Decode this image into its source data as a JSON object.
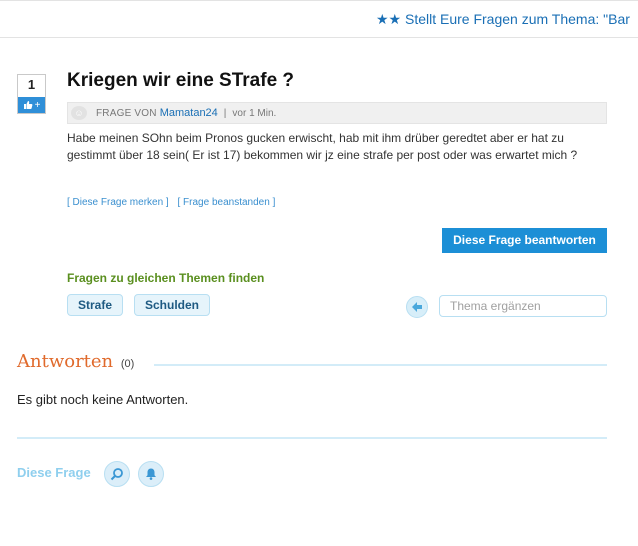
{
  "ticker": {
    "text": "★★ Stellt Eure Fragen zum Thema: \"Bar"
  },
  "question": {
    "votes": "1",
    "title": "Kriegen wir eine STrafe ?",
    "meta_label": "Frage von",
    "author": "Mamatan24",
    "time": "vor 1 Min.",
    "body": "Habe meinen SOhn beim Pronos gucken erwischt, hab mit ihm drüber geredtet aber er hat zu gestimmt über 18 sein( Er ist 17) bekommen wir jz eine strafe per post oder was erwartet mich ?",
    "link_merken": "[ Diese Frage merken ]",
    "link_beanstanden": "[ Frage beanstanden ]",
    "answer_button": "Diese Frage beantworten"
  },
  "topics": {
    "heading": "Fragen zu gleichen Themen finden",
    "tags": [
      "Strafe",
      "Schulden"
    ],
    "input_placeholder": "Thema ergänzen"
  },
  "answers": {
    "heading": "Antworten",
    "count": "(0)",
    "empty_text": "Es gibt noch keine Antworten."
  },
  "footer": {
    "label": "Diese Frage"
  },
  "colors": {
    "accent_blue": "#1c8fd6",
    "topic_green": "#5a8f1f",
    "answers_orange": "#e06a2c"
  }
}
